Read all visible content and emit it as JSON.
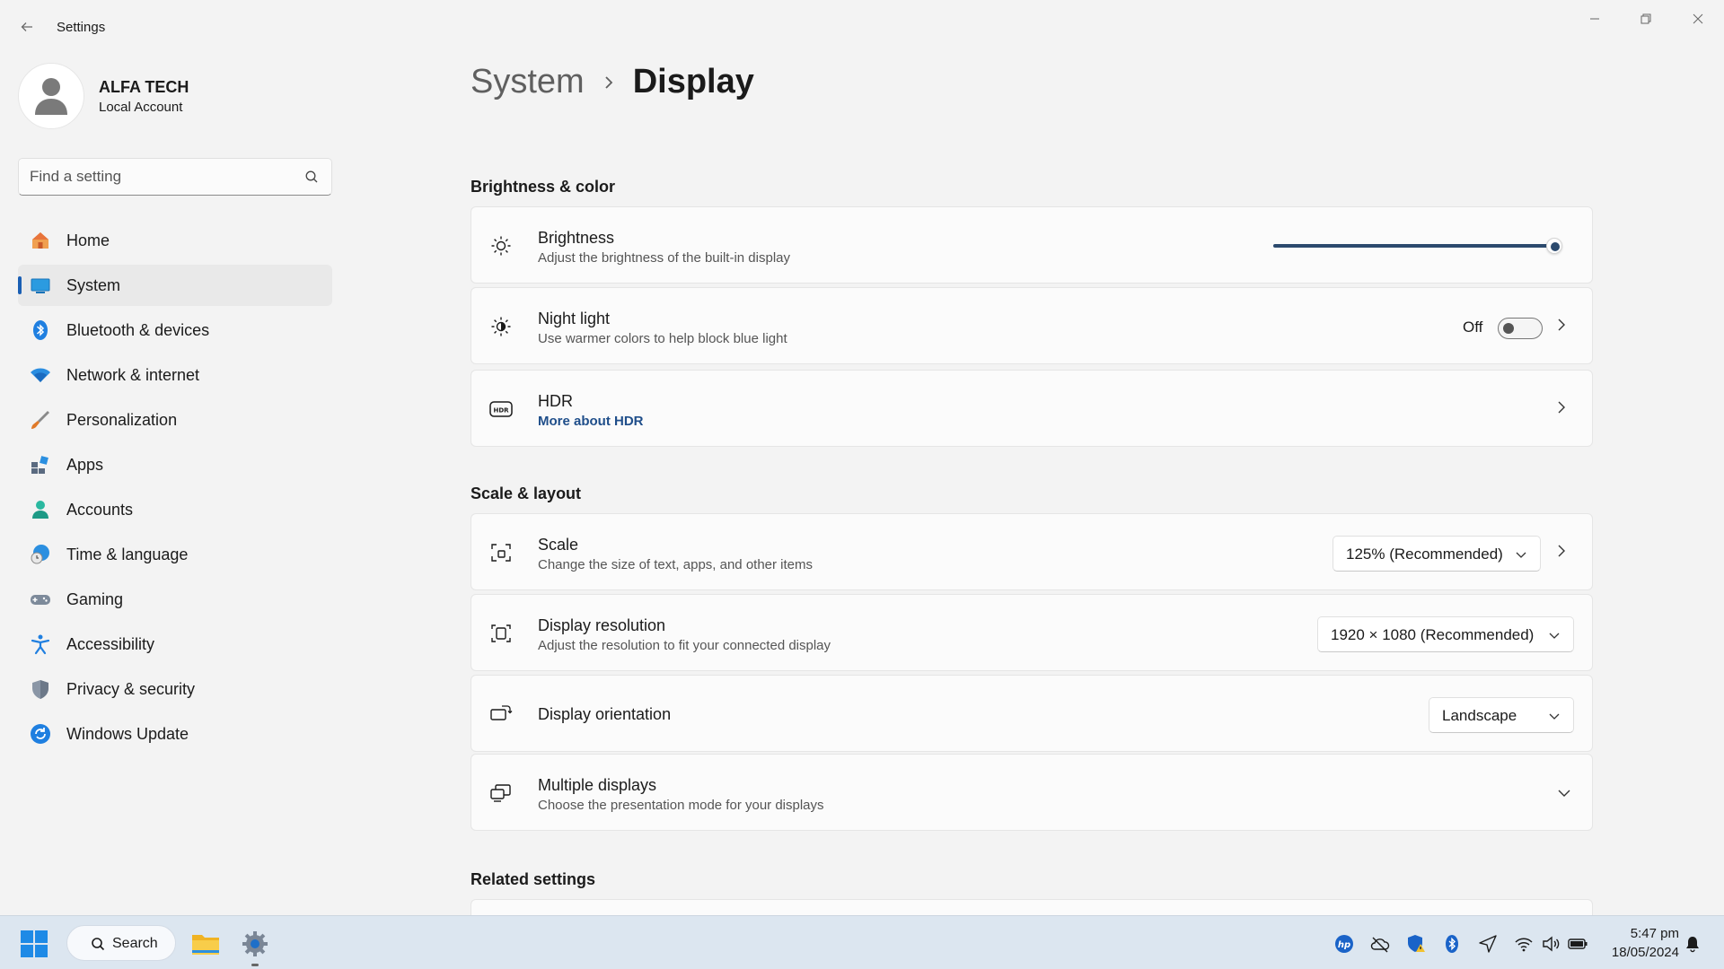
{
  "window": {
    "app_title": "Settings"
  },
  "profile": {
    "name": "ALFA TECH",
    "account_type": "Local Account"
  },
  "search": {
    "placeholder": "Find a setting"
  },
  "sidebar": {
    "items": [
      {
        "label": "Home",
        "icon": "home-icon"
      },
      {
        "label": "System",
        "icon": "system-icon",
        "active": true
      },
      {
        "label": "Bluetooth & devices",
        "icon": "bluetooth-icon"
      },
      {
        "label": "Network & internet",
        "icon": "wifi-icon"
      },
      {
        "label": "Personalization",
        "icon": "brush-icon"
      },
      {
        "label": "Apps",
        "icon": "apps-icon"
      },
      {
        "label": "Accounts",
        "icon": "accounts-icon"
      },
      {
        "label": "Time & language",
        "icon": "globe-clock-icon"
      },
      {
        "label": "Gaming",
        "icon": "gamepad-icon"
      },
      {
        "label": "Accessibility",
        "icon": "accessibility-icon"
      },
      {
        "label": "Privacy & security",
        "icon": "shield-icon"
      },
      {
        "label": "Windows Update",
        "icon": "update-icon"
      }
    ]
  },
  "breadcrumb": {
    "parent": "System",
    "current": "Display"
  },
  "sections": {
    "brightness_color": "Brightness & color",
    "scale_layout": "Scale & layout",
    "related": "Related settings"
  },
  "settings": {
    "brightness": {
      "title": "Brightness",
      "desc": "Adjust the brightness of the built-in display",
      "value_percent": 100
    },
    "night_light": {
      "title": "Night light",
      "desc": "Use warmer colors to help block blue light",
      "state": "Off"
    },
    "hdr": {
      "title": "HDR",
      "link": "More about HDR"
    },
    "scale": {
      "title": "Scale",
      "desc": "Change the size of text, apps, and other items",
      "value": "125% (Recommended)"
    },
    "resolution": {
      "title": "Display resolution",
      "desc": "Adjust the resolution to fit your connected display",
      "value": "1920 × 1080 (Recommended)"
    },
    "orientation": {
      "title": "Display orientation",
      "value": "Landscape"
    },
    "multiple": {
      "title": "Multiple displays",
      "desc": "Choose the presentation mode for your displays"
    }
  },
  "taskbar": {
    "search_label": "Search",
    "time": "5:47 pm",
    "date": "18/05/2024"
  },
  "colors": {
    "accent": "#1a5fb4",
    "slider": "#2c4a6e",
    "taskbar": "#dce6f0"
  }
}
